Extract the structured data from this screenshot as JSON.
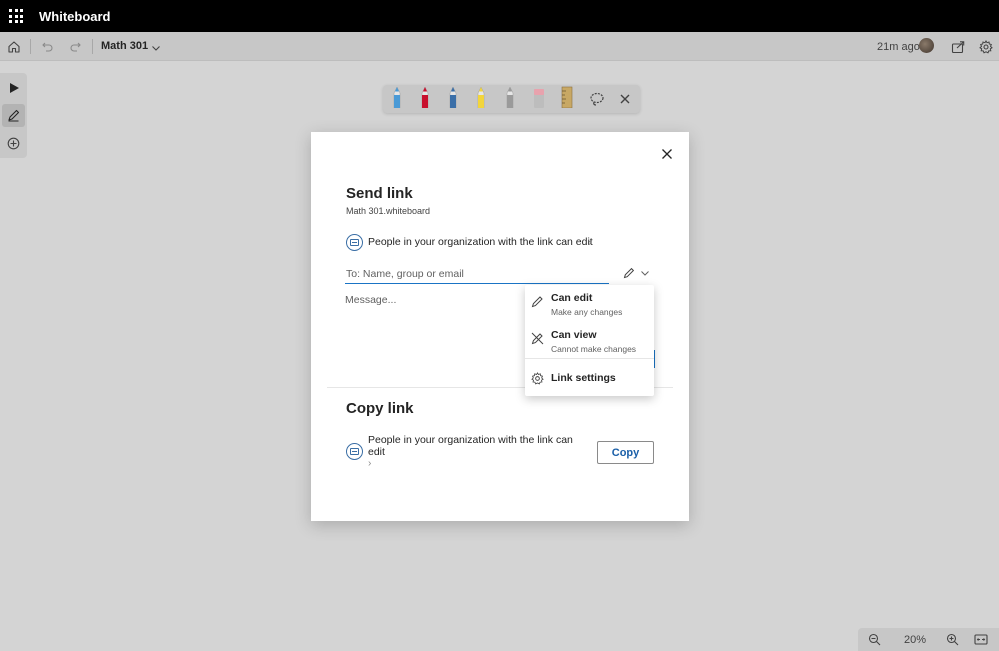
{
  "app": {
    "title": "Whiteboard"
  },
  "commandbar": {
    "board_name": "Math 301",
    "saved_time": "21m ago"
  },
  "icons": {
    "app_launcher": "waffle-icon",
    "home": "home-icon",
    "undo": "undo-icon",
    "redo": "redo-icon",
    "board_menu": "chevron-down-icon",
    "share": "share-icon",
    "settings": "gear-icon",
    "select_tool": "pointer-icon",
    "ink_tool": "pen-icon",
    "add_tool": "plus-circle-icon",
    "lasso": "lasso-icon",
    "close_tray": "close-icon",
    "zoom_out": "zoom-out-icon",
    "zoom_in": "zoom-in-icon",
    "fit_screen": "fit-screen-icon",
    "org_link": "organization-icon",
    "permission_picker": "pencil-icon",
    "can_edit": "pencil-icon",
    "can_view": "pencil-off-icon",
    "link_settings": "gear-icon"
  },
  "pen_tray": {
    "pens": [
      {
        "name": "blue-pen",
        "color": "#4a9ad6"
      },
      {
        "name": "red-pen",
        "color": "#c8102e"
      },
      {
        "name": "dark-blue-pen",
        "color": "#3b6fa8"
      },
      {
        "name": "yellow-highlighter",
        "color": "#f2d53c"
      },
      {
        "name": "gray-pen",
        "color": "#9a9a9a"
      },
      {
        "name": "pink-eraser",
        "color": "#e8a2ad"
      },
      {
        "name": "ruler",
        "color": "#c8a864"
      }
    ]
  },
  "zoom": {
    "level": "20%"
  },
  "dialog": {
    "title": "Send link",
    "subtitle": "Math 301.whiteboard",
    "permission_text": "People in your organization with the link can edit",
    "permission_chevron": "›",
    "to_placeholder": "To: Name, group or email",
    "message_placeholder": "Message...",
    "copy_title": "Copy link",
    "copy_permission_text": "People in your organization with the link can edit",
    "copy_chevron": "›",
    "copy_button": "Copy"
  },
  "permission_menu": {
    "items": [
      {
        "title": "Can edit",
        "desc": "Make any changes"
      },
      {
        "title": "Can view",
        "desc": "Cannot make changes"
      },
      {
        "title": "Link settings",
        "desc": ""
      }
    ]
  }
}
